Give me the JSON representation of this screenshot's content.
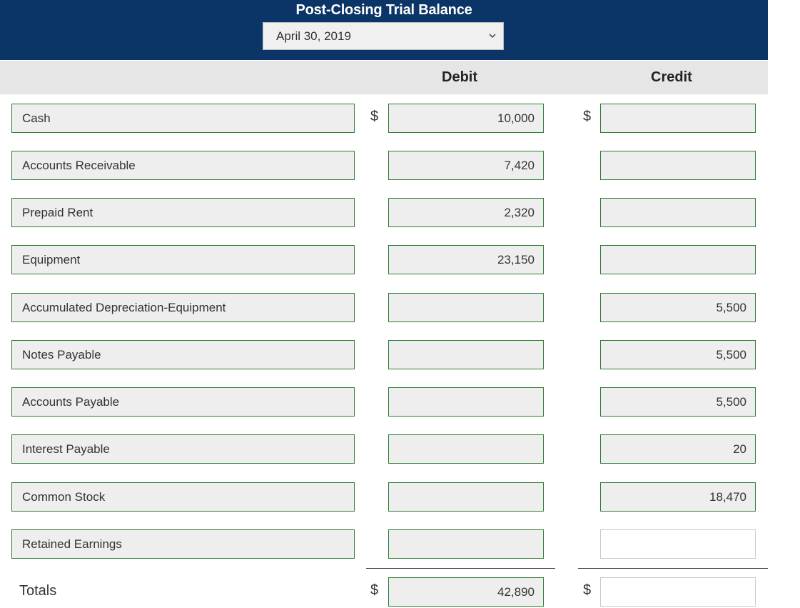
{
  "header": {
    "title": "Post-Closing Trial Balance",
    "date_selected": "April 30, 2019"
  },
  "columns": {
    "debit": "Debit",
    "credit": "Credit"
  },
  "currency_symbol": "$",
  "rows": [
    {
      "account": "Cash",
      "debit": "10,000",
      "credit": ""
    },
    {
      "account": "Accounts Receivable",
      "debit": "7,420",
      "credit": ""
    },
    {
      "account": "Prepaid Rent",
      "debit": "2,320",
      "credit": ""
    },
    {
      "account": "Equipment",
      "debit": "23,150",
      "credit": ""
    },
    {
      "account": "Accumulated Depreciation-Equipment",
      "debit": "",
      "credit": "5,500"
    },
    {
      "account": "Notes Payable",
      "debit": "",
      "credit": "5,500"
    },
    {
      "account": "Accounts Payable",
      "debit": "",
      "credit": "5,500"
    },
    {
      "account": "Interest Payable",
      "debit": "",
      "credit": "20"
    },
    {
      "account": "Common Stock",
      "debit": "",
      "credit": "18,470"
    },
    {
      "account": "Retained Earnings",
      "debit": "",
      "credit": ""
    }
  ],
  "totals": {
    "label": "Totals",
    "debit": "42,890",
    "credit": ""
  },
  "colors": {
    "header_bg": "#0a3566",
    "field_border": "#2e7d32",
    "field_bg": "#eeeeee"
  }
}
